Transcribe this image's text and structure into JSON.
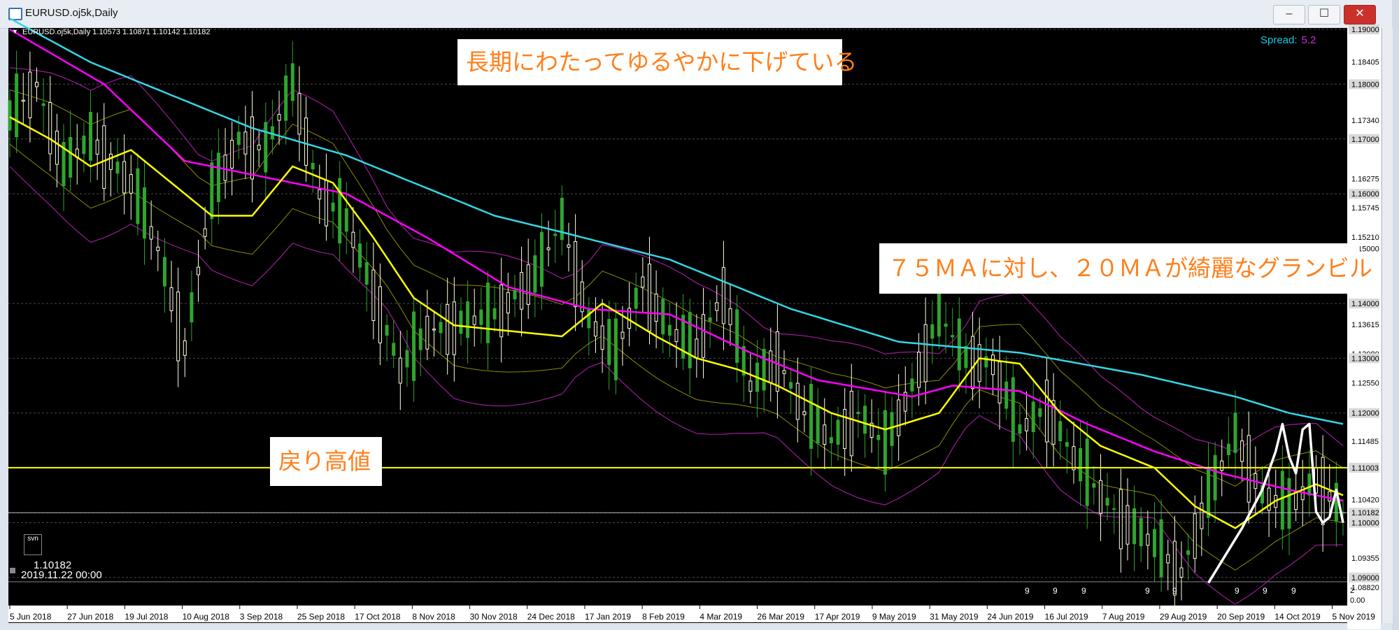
{
  "window": {
    "title": "EURUSD.oj5k,Daily",
    "buttons": [
      "–",
      "☐",
      "✕"
    ]
  },
  "info_bar": {
    "text": "EURUSD.oj5k,Daily  1.10573 1.10871 1.10142 1.10182"
  },
  "spread": {
    "label": "Spread:",
    "value": "5.2"
  },
  "annotations": {
    "long_term": "長期にわたってゆるやかに下げている",
    "ma_note": "７５ＭＡに対し、２０ＭＡが綺麗なグランビル",
    "pullback_high": "戻り高値"
  },
  "cursor": {
    "box_label": "svn",
    "price": "1.10182",
    "time": "2019.11.22 00:00"
  },
  "colors": {
    "background": "#000000",
    "ma20": "#ffff00",
    "ma75": "#ff00ff",
    "ma200": "#33d6e6",
    "candle_up": "#ffffe0",
    "candle_down": "#2fa52f",
    "bollinger_outer": "#9c1c9c",
    "bollinger_inner": "#8d8d00",
    "horizontal_line": "#ffff00",
    "annotation_text": "#ff7f1a",
    "hand_drawn": "#ffffff"
  },
  "price_axis": {
    "labels": [
      "1.19000",
      "1.18405",
      "1.18000",
      "1.17340",
      "1.17000",
      "1.16275",
      "1.16000",
      "1.15745",
      "1.15210",
      "1.15000",
      "1.14000",
      "1.13615",
      "1.13080",
      "1.13000",
      "1.12550",
      "1.12000",
      "1.11485",
      "1.11003",
      "1.10420",
      "1.10182",
      "1.10000",
      "1.09355",
      "1.09000",
      "1.08820"
    ],
    "highlighted": [
      "1.19000",
      "1.18000",
      "1.17000",
      "1.16000",
      "1.14000",
      "1.13000",
      "1.12000",
      "1.11003",
      "1.10182",
      "1.10000",
      "1.09000"
    ],
    "sub_labels": [
      "2",
      "0.00"
    ]
  },
  "time_axis": {
    "labels": [
      "5 Jun 2018",
      "27 Jun 2018",
      "19 Jul 2018",
      "10 Aug 2018",
      "3 Sep 2018",
      "25 Sep 2018",
      "17 Oct 2018",
      "8 Nov 2018",
      "30 Nov 2018",
      "24 Dec 2018",
      "17 Jan 2019",
      "8 Feb 2019",
      "4 Mar 2019",
      "26 Mar 2019",
      "17 Apr 2019",
      "9 May 2019",
      "31 May 2019",
      "24 Jun 2019",
      "16 Jul 2019",
      "7 Aug 2019",
      "29 Aug 2019",
      "20 Sep 2019",
      "14 Oct 2019",
      "5 Nov 2019"
    ]
  },
  "sub_window_marks": [
    "9",
    "9",
    "9",
    "9",
    "9",
    "9",
    "9",
    "9"
  ],
  "chart_data": {
    "type": "candlestick",
    "symbol": "EURUSD.oj5k",
    "timeframe": "Daily",
    "ylim": [
      1.0882,
      1.19
    ],
    "last": {
      "open": 1.10573,
      "high": 1.10871,
      "low": 1.10142,
      "close": 1.10182
    },
    "horizontal_line": 1.11003,
    "ma200": [
      [
        0,
        1.192
      ],
      [
        12,
        1.184
      ],
      [
        22,
        1.179
      ],
      [
        36,
        1.172
      ],
      [
        50,
        1.167
      ],
      [
        62,
        1.161
      ],
      [
        72,
        1.156
      ],
      [
        82,
        1.153
      ],
      [
        98,
        1.148
      ],
      [
        106,
        1.144
      ],
      [
        116,
        1.139
      ],
      [
        132,
        1.133
      ],
      [
        150,
        1.131
      ],
      [
        168,
        1.127
      ],
      [
        182,
        1.123
      ],
      [
        190,
        1.12
      ],
      [
        198,
        1.118
      ]
    ],
    "ma75": [
      [
        0,
        1.19
      ],
      [
        14,
        1.18
      ],
      [
        26,
        1.166
      ],
      [
        38,
        1.163
      ],
      [
        50,
        1.16
      ],
      [
        62,
        1.152
      ],
      [
        74,
        1.143
      ],
      [
        86,
        1.139
      ],
      [
        98,
        1.138
      ],
      [
        110,
        1.131
      ],
      [
        120,
        1.126
      ],
      [
        134,
        1.123
      ],
      [
        140,
        1.125
      ],
      [
        150,
        1.124
      ],
      [
        160,
        1.118
      ],
      [
        170,
        1.113
      ],
      [
        180,
        1.109
      ],
      [
        190,
        1.106
      ],
      [
        198,
        1.104
      ]
    ],
    "ma20": [
      [
        0,
        1.174
      ],
      [
        6,
        1.17
      ],
      [
        12,
        1.165
      ],
      [
        18,
        1.168
      ],
      [
        24,
        1.162
      ],
      [
        30,
        1.156
      ],
      [
        36,
        1.156
      ],
      [
        42,
        1.165
      ],
      [
        48,
        1.162
      ],
      [
        54,
        1.152
      ],
      [
        60,
        1.141
      ],
      [
        66,
        1.136
      ],
      [
        74,
        1.135
      ],
      [
        82,
        1.134
      ],
      [
        88,
        1.14
      ],
      [
        96,
        1.134
      ],
      [
        102,
        1.13
      ],
      [
        108,
        1.128
      ],
      [
        114,
        1.125
      ],
      [
        122,
        1.12
      ],
      [
        130,
        1.117
      ],
      [
        138,
        1.12
      ],
      [
        144,
        1.13
      ],
      [
        150,
        1.129
      ],
      [
        156,
        1.12
      ],
      [
        162,
        1.114
      ],
      [
        170,
        1.11
      ],
      [
        176,
        1.103
      ],
      [
        182,
        1.099
      ],
      [
        188,
        1.104
      ],
      [
        194,
        1.107
      ],
      [
        198,
        1.105
      ]
    ],
    "price_path": [
      [
        0,
        1.174
      ],
      [
        4,
        1.18
      ],
      [
        8,
        1.165
      ],
      [
        12,
        1.17
      ],
      [
        18,
        1.162
      ],
      [
        22,
        1.15
      ],
      [
        26,
        1.132
      ],
      [
        30,
        1.16
      ],
      [
        34,
        1.17
      ],
      [
        38,
        1.168
      ],
      [
        42,
        1.18
      ],
      [
        46,
        1.16
      ],
      [
        50,
        1.155
      ],
      [
        54,
        1.142
      ],
      [
        58,
        1.128
      ],
      [
        62,
        1.135
      ],
      [
        66,
        1.136
      ],
      [
        72,
        1.138
      ],
      [
        78,
        1.145
      ],
      [
        82,
        1.155
      ],
      [
        86,
        1.137
      ],
      [
        90,
        1.131
      ],
      [
        94,
        1.144
      ],
      [
        98,
        1.135
      ],
      [
        102,
        1.132
      ],
      [
        106,
        1.142
      ],
      [
        110,
        1.125
      ],
      [
        114,
        1.13
      ],
      [
        118,
        1.12
      ],
      [
        122,
        1.115
      ],
      [
        126,
        1.12
      ],
      [
        130,
        1.114
      ],
      [
        134,
        1.125
      ],
      [
        138,
        1.138
      ],
      [
        142,
        1.13
      ],
      [
        146,
        1.129
      ],
      [
        150,
        1.117
      ],
      [
        154,
        1.121
      ],
      [
        158,
        1.112
      ],
      [
        162,
        1.105
      ],
      [
        166,
        1.1
      ],
      [
        170,
        1.096
      ],
      [
        174,
        1.091
      ],
      [
        178,
        1.105
      ],
      [
        182,
        1.116
      ],
      [
        186,
        1.105
      ],
      [
        190,
        1.103
      ],
      [
        194,
        1.108
      ],
      [
        198,
        1.1018
      ]
    ]
  }
}
